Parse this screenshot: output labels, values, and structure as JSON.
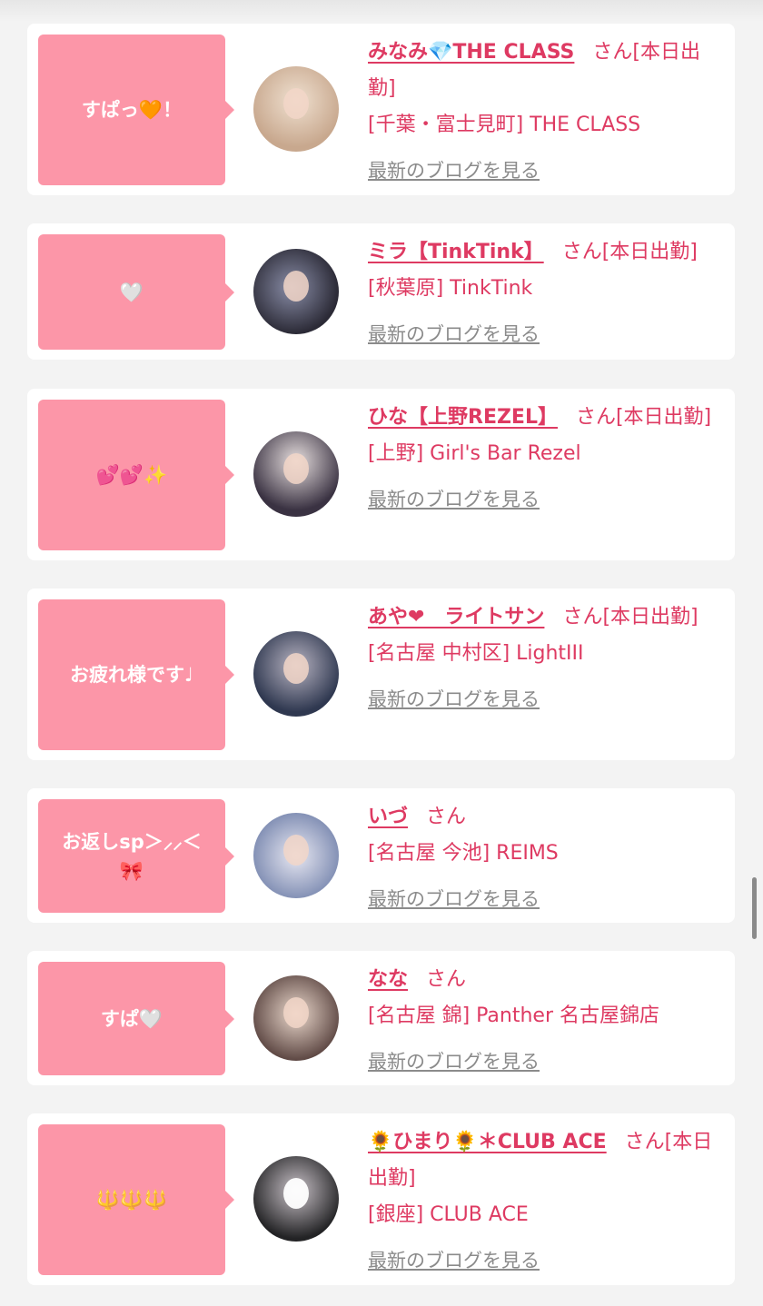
{
  "entries": [
    {
      "comment": "すぱっ🧡！",
      "name": "みなみ💎THE CLASS",
      "suffix": "さん[本日出勤]",
      "shop": "[千葉・富士見町] THE CLASS",
      "blog_link": "最新のブログを見る",
      "avatar_colors": [
        "#c8a88e",
        "#efe0d0"
      ]
    },
    {
      "comment": "🤍",
      "name": "ミラ【TinkTink】",
      "suffix": "さん[本日出勤]",
      "shop": "[秋葉原] TinkTink",
      "blog_link": "最新のブログを見る",
      "avatar_colors": [
        "#2b2a36",
        "#8a8ea8"
      ]
    },
    {
      "comment": "💕💕✨",
      "name": "ひな【上野REZEL】",
      "suffix": "さん[本日出勤]",
      "shop": "[上野] Girl's Bar Rezel",
      "blog_link": "最新のブログを見る",
      "avatar_colors": [
        "#3a3242",
        "#e6dede"
      ]
    },
    {
      "comment": "お疲れ様です♩",
      "name": "あや❤︎　ライトサン",
      "suffix": "さん[本日出勤]",
      "shop": "[名古屋 中村区] LightIII",
      "blog_link": "最新のブログを見る",
      "avatar_colors": [
        "#2f3850",
        "#b8b4c2"
      ]
    },
    {
      "comment": "お返しsp＞⸝⸝＜🎀",
      "name": "いづ",
      "suffix": "さん",
      "shop": "[名古屋 今池] REIMS",
      "blog_link": "最新のブログを見る",
      "avatar_colors": [
        "#7e8cb2",
        "#e8e8f2"
      ]
    },
    {
      "comment": "すぱ🤍",
      "name": "なな",
      "suffix": "さん",
      "shop": "[名古屋 錦] Panther 名古屋錦店",
      "blog_link": "最新のブログを見る",
      "avatar_colors": [
        "#5a4440",
        "#ead8cc"
      ]
    },
    {
      "comment": "🔱🔱🔱",
      "name": "🌻ひまり🌻＊CLUB ACE",
      "suffix": "さん[本日出勤]",
      "shop": "[銀座] CLUB ACE",
      "blog_link": "最新のブログを見る",
      "avatar_colors": [
        "#232325",
        "#c9c2c8"
      ]
    }
  ],
  "colors": {
    "accent": "#de3a62",
    "bubble": "#fc96a8",
    "blog_link": "#8b8b8b",
    "background": "#f3f3f3"
  }
}
